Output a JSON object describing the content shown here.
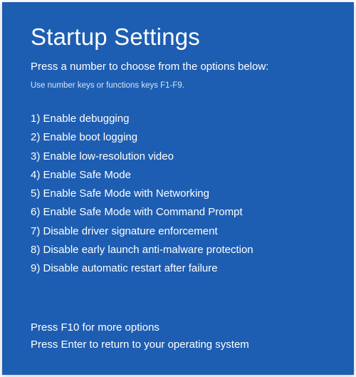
{
  "title": "Startup Settings",
  "subtitle": "Press a number to choose from the options below:",
  "hint": "Use number keys or functions keys F1-F9.",
  "options": [
    "1) Enable debugging",
    "2) Enable boot logging",
    "3) Enable low-resolution video",
    "4) Enable Safe Mode",
    "5) Enable Safe Mode with Networking",
    "6) Enable Safe Mode with Command Prompt",
    "7) Disable driver signature enforcement",
    "8) Disable early launch anti-malware protection",
    "9) Disable automatic restart after failure"
  ],
  "footer": {
    "more": "Press F10 for more options",
    "back": "Press Enter to return to your operating system"
  },
  "colors": {
    "background": "#1e5eb2",
    "text": "#ffffff"
  }
}
